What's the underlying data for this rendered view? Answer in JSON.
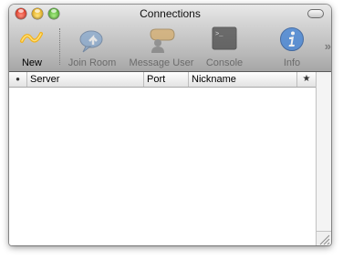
{
  "window": {
    "title": "Connections"
  },
  "toolbar": {
    "items": [
      {
        "label": "New",
        "icon": "new-connection-icon",
        "enabled": true
      },
      {
        "label": "Join Room",
        "icon": "join-room-icon",
        "enabled": false
      },
      {
        "label": "Message User",
        "icon": "message-user-icon",
        "enabled": false
      },
      {
        "label": "Console",
        "icon": "console-icon",
        "enabled": false
      },
      {
        "label": "Info",
        "icon": "info-icon",
        "enabled": false
      }
    ],
    "overflow_glyph": "»"
  },
  "table": {
    "status_header": "●",
    "columns": [
      "Server",
      "Port",
      "Nickname"
    ],
    "favorite_header": "★",
    "rows": []
  },
  "colors": {
    "enabled_label": "#000000",
    "disabled_label": "#6b6b6b",
    "info_blue": "#3b7fd6"
  }
}
